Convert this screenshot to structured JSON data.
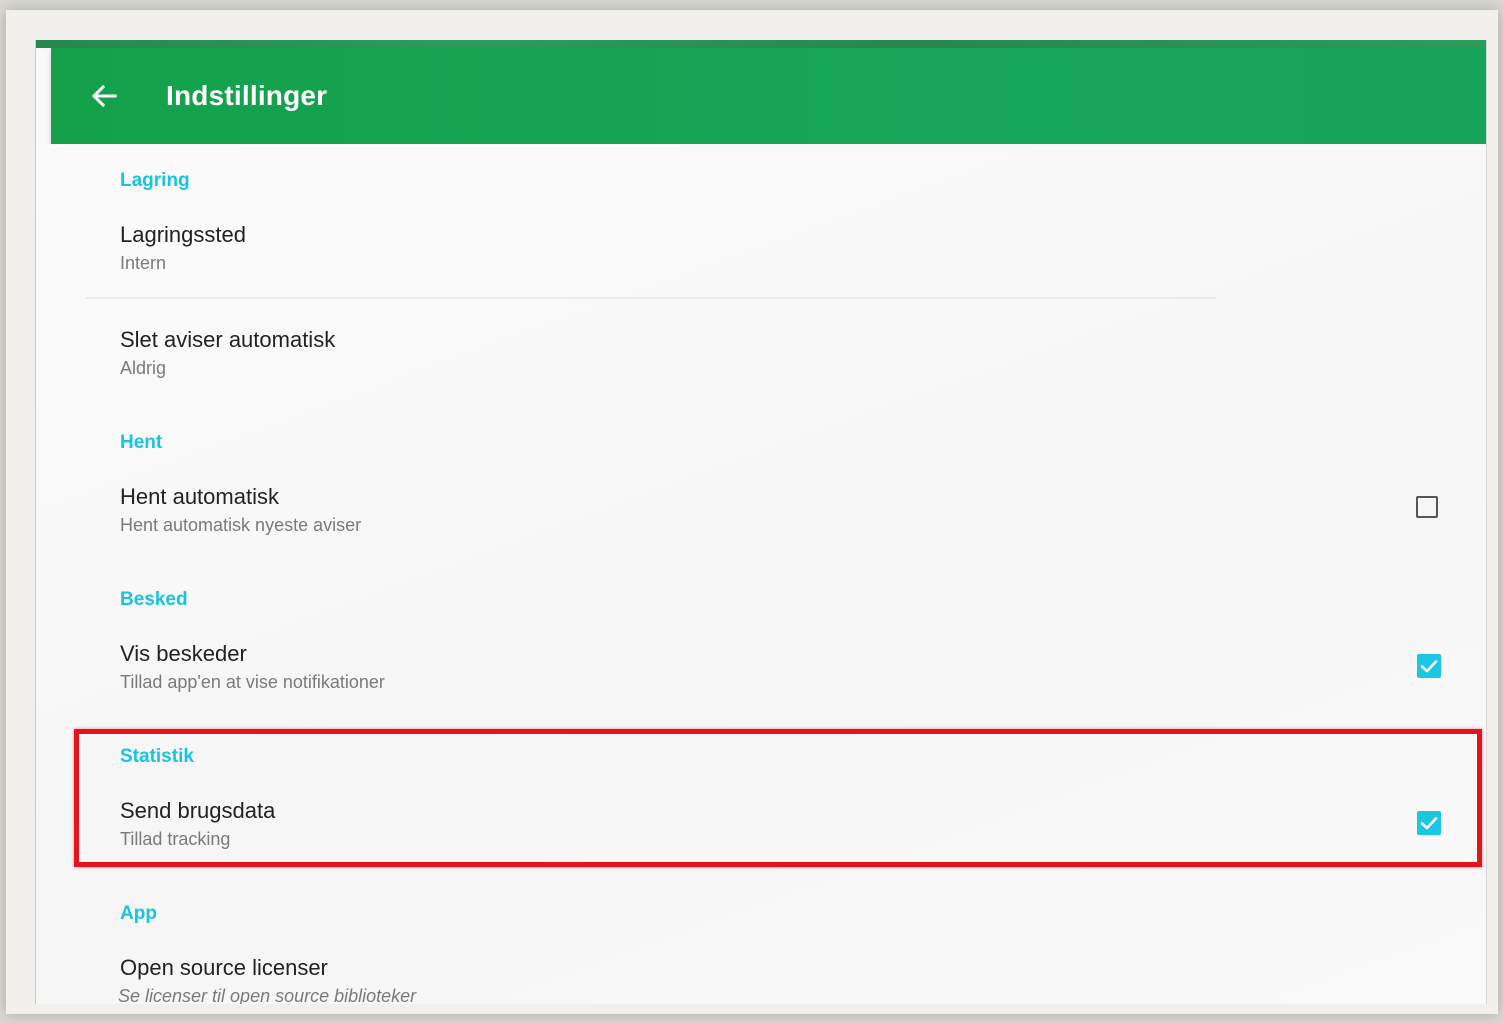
{
  "app_bar": {
    "title": "Indstillinger",
    "back_icon": "arrow-left-icon",
    "color": "#17a656"
  },
  "accent_color": "#1bc7e2",
  "highlight_color": "#e3141b",
  "sections": {
    "lagring": {
      "header": "Lagring",
      "items": [
        {
          "title": "Lagringssted",
          "summary": "Intern"
        },
        {
          "title": "Slet aviser automatisk",
          "summary": "Aldrig"
        }
      ]
    },
    "hent": {
      "header": "Hent",
      "items": [
        {
          "title": "Hent automatisk",
          "summary": "Hent automatisk nyeste aviser",
          "checked": false
        }
      ]
    },
    "besked": {
      "header": "Besked",
      "items": [
        {
          "title": "Vis beskeder",
          "summary": "Tillad app'en at vise notifikationer",
          "checked": true
        }
      ]
    },
    "statistik": {
      "header": "Statistik",
      "items": [
        {
          "title": "Send brugsdata",
          "summary": "Tillad tracking",
          "checked": true
        }
      ]
    },
    "app": {
      "header": "App",
      "items": [
        {
          "title": "Open source licenser",
          "summary": "Se licenser til open source biblioteker"
        }
      ]
    }
  }
}
